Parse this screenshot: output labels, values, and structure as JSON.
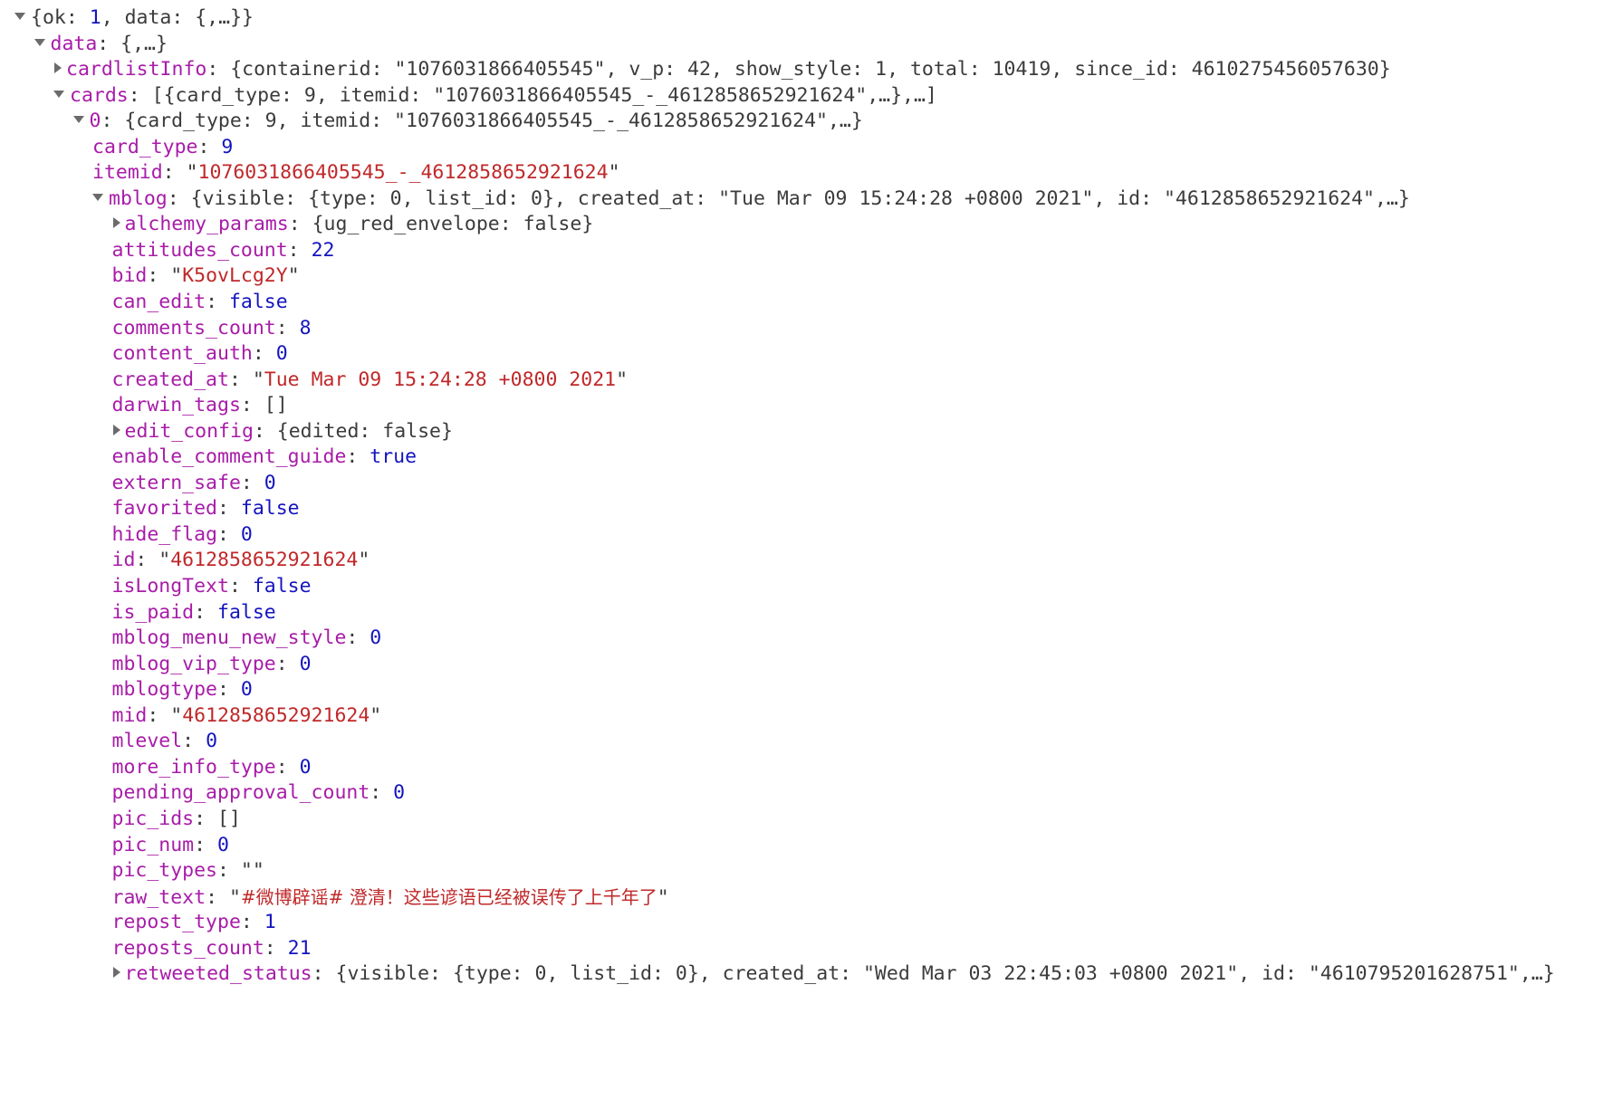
{
  "viewer": {
    "kind": "json-tree",
    "colors": {
      "key": "#a81ca8",
      "string": "#c0282a",
      "number": "#1414bf",
      "boolean": "#1414bf",
      "punctuation": "#3b3b3b",
      "arrow": "#6b6b6b",
      "background": "#ffffff"
    }
  },
  "rows": [
    {
      "id": "root",
      "indent": 0,
      "arrow": "expanded",
      "arrow_icon": "triangle-down-icon",
      "segments": [
        {
          "t": "punct",
          "v": "{"
        },
        {
          "t": "plain",
          "v": "ok: "
        },
        {
          "t": "num",
          "v": "1"
        },
        {
          "t": "plain",
          "v": ", data: {,…}}"
        }
      ]
    },
    {
      "id": "data",
      "indent": 1,
      "arrow": "expanded",
      "arrow_icon": "triangle-down-icon",
      "segments": [
        {
          "t": "key",
          "v": "data"
        },
        {
          "t": "punct",
          "v": ": "
        },
        {
          "t": "plain",
          "v": "{,…}"
        }
      ]
    },
    {
      "id": "cardlistInfo",
      "indent": 2,
      "arrow": "collapsed",
      "arrow_icon": "triangle-right-icon",
      "segments": [
        {
          "t": "key",
          "v": "cardlistInfo"
        },
        {
          "t": "punct",
          "v": ": "
        },
        {
          "t": "plain",
          "v": "{containerid: \"1076031866405545\", v_p: 42, show_style: 1, total: 10419, since_id: 4610275456057630}"
        }
      ]
    },
    {
      "id": "cards",
      "indent": 2,
      "arrow": "expanded",
      "arrow_icon": "triangle-down-icon",
      "segments": [
        {
          "t": "key",
          "v": "cards"
        },
        {
          "t": "punct",
          "v": ": "
        },
        {
          "t": "plain",
          "v": "[{card_type: 9, itemid: \"1076031866405545_-_4612858652921624\",…},…]"
        }
      ]
    },
    {
      "id": "cards-0",
      "indent": 3,
      "arrow": "expanded",
      "arrow_icon": "triangle-down-icon",
      "segments": [
        {
          "t": "key",
          "v": "0"
        },
        {
          "t": "punct",
          "v": ": "
        },
        {
          "t": "plain",
          "v": "{card_type: 9, itemid: \"1076031866405545_-_4612858652921624\",…}"
        }
      ]
    },
    {
      "id": "card_type",
      "indent": 4,
      "arrow": "none",
      "segments": [
        {
          "t": "key",
          "v": "card_type"
        },
        {
          "t": "punct",
          "v": ": "
        },
        {
          "t": "num",
          "v": "9"
        }
      ]
    },
    {
      "id": "itemid",
      "indent": 4,
      "arrow": "none",
      "segments": [
        {
          "t": "key",
          "v": "itemid"
        },
        {
          "t": "punct",
          "v": ": "
        },
        {
          "t": "punct",
          "v": "\""
        },
        {
          "t": "str",
          "v": "1076031866405545_-_4612858652921624"
        },
        {
          "t": "punct",
          "v": "\""
        }
      ]
    },
    {
      "id": "mblog",
      "indent": 4,
      "arrow": "expanded",
      "arrow_icon": "triangle-down-icon",
      "segments": [
        {
          "t": "key",
          "v": "mblog"
        },
        {
          "t": "punct",
          "v": ": "
        },
        {
          "t": "plain",
          "v": "{visible: {type: 0, list_id: 0}, created_at: \"Tue Mar 09 15:24:28 +0800 2021\", id: \"4612858652921624\",…}"
        }
      ]
    },
    {
      "id": "alchemy_params",
      "indent": 5,
      "arrow": "collapsed",
      "arrow_icon": "triangle-right-icon",
      "segments": [
        {
          "t": "key",
          "v": "alchemy_params"
        },
        {
          "t": "punct",
          "v": ": "
        },
        {
          "t": "plain",
          "v": "{ug_red_envelope: false}"
        }
      ]
    },
    {
      "id": "attitudes_count",
      "indent": 5,
      "arrow": "none",
      "segments": [
        {
          "t": "key",
          "v": "attitudes_count"
        },
        {
          "t": "punct",
          "v": ": "
        },
        {
          "t": "num",
          "v": "22"
        }
      ]
    },
    {
      "id": "bid",
      "indent": 5,
      "arrow": "none",
      "segments": [
        {
          "t": "key",
          "v": "bid"
        },
        {
          "t": "punct",
          "v": ": "
        },
        {
          "t": "punct",
          "v": "\""
        },
        {
          "t": "str",
          "v": "K5ovLcg2Y"
        },
        {
          "t": "punct",
          "v": "\""
        }
      ]
    },
    {
      "id": "can_edit",
      "indent": 5,
      "arrow": "none",
      "segments": [
        {
          "t": "key",
          "v": "can_edit"
        },
        {
          "t": "punct",
          "v": ": "
        },
        {
          "t": "bool",
          "v": "false"
        }
      ]
    },
    {
      "id": "comments_count",
      "indent": 5,
      "arrow": "none",
      "segments": [
        {
          "t": "key",
          "v": "comments_count"
        },
        {
          "t": "punct",
          "v": ": "
        },
        {
          "t": "num",
          "v": "8"
        }
      ]
    },
    {
      "id": "content_auth",
      "indent": 5,
      "arrow": "none",
      "segments": [
        {
          "t": "key",
          "v": "content_auth"
        },
        {
          "t": "punct",
          "v": ": "
        },
        {
          "t": "num",
          "v": "0"
        }
      ]
    },
    {
      "id": "created_at",
      "indent": 5,
      "arrow": "none",
      "segments": [
        {
          "t": "key",
          "v": "created_at"
        },
        {
          "t": "punct",
          "v": ": "
        },
        {
          "t": "punct",
          "v": "\""
        },
        {
          "t": "str",
          "v": "Tue Mar 09 15:24:28 +0800 2021"
        },
        {
          "t": "punct",
          "v": "\""
        }
      ]
    },
    {
      "id": "darwin_tags",
      "indent": 5,
      "arrow": "none",
      "segments": [
        {
          "t": "key",
          "v": "darwin_tags"
        },
        {
          "t": "punct",
          "v": ": "
        },
        {
          "t": "plain",
          "v": "[]"
        }
      ]
    },
    {
      "id": "edit_config",
      "indent": 5,
      "arrow": "collapsed",
      "arrow_icon": "triangle-right-icon",
      "segments": [
        {
          "t": "key",
          "v": "edit_config"
        },
        {
          "t": "punct",
          "v": ": "
        },
        {
          "t": "plain",
          "v": "{edited: false}"
        }
      ]
    },
    {
      "id": "enable_comment_guide",
      "indent": 5,
      "arrow": "none",
      "segments": [
        {
          "t": "key",
          "v": "enable_comment_guide"
        },
        {
          "t": "punct",
          "v": ": "
        },
        {
          "t": "bool",
          "v": "true"
        }
      ]
    },
    {
      "id": "extern_safe",
      "indent": 5,
      "arrow": "none",
      "segments": [
        {
          "t": "key",
          "v": "extern_safe"
        },
        {
          "t": "punct",
          "v": ": "
        },
        {
          "t": "num",
          "v": "0"
        }
      ]
    },
    {
      "id": "favorited",
      "indent": 5,
      "arrow": "none",
      "segments": [
        {
          "t": "key",
          "v": "favorited"
        },
        {
          "t": "punct",
          "v": ": "
        },
        {
          "t": "bool",
          "v": "false"
        }
      ]
    },
    {
      "id": "hide_flag",
      "indent": 5,
      "arrow": "none",
      "segments": [
        {
          "t": "key",
          "v": "hide_flag"
        },
        {
          "t": "punct",
          "v": ": "
        },
        {
          "t": "num",
          "v": "0"
        }
      ]
    },
    {
      "id": "id",
      "indent": 5,
      "arrow": "none",
      "segments": [
        {
          "t": "key",
          "v": "id"
        },
        {
          "t": "punct",
          "v": ": "
        },
        {
          "t": "punct",
          "v": "\""
        },
        {
          "t": "str",
          "v": "4612858652921624"
        },
        {
          "t": "punct",
          "v": "\""
        }
      ]
    },
    {
      "id": "isLongText",
      "indent": 5,
      "arrow": "none",
      "segments": [
        {
          "t": "key",
          "v": "isLongText"
        },
        {
          "t": "punct",
          "v": ": "
        },
        {
          "t": "bool",
          "v": "false"
        }
      ]
    },
    {
      "id": "is_paid",
      "indent": 5,
      "arrow": "none",
      "segments": [
        {
          "t": "key",
          "v": "is_paid"
        },
        {
          "t": "punct",
          "v": ": "
        },
        {
          "t": "bool",
          "v": "false"
        }
      ]
    },
    {
      "id": "mblog_menu_new_style",
      "indent": 5,
      "arrow": "none",
      "segments": [
        {
          "t": "key",
          "v": "mblog_menu_new_style"
        },
        {
          "t": "punct",
          "v": ": "
        },
        {
          "t": "num",
          "v": "0"
        }
      ]
    },
    {
      "id": "mblog_vip_type",
      "indent": 5,
      "arrow": "none",
      "segments": [
        {
          "t": "key",
          "v": "mblog_vip_type"
        },
        {
          "t": "punct",
          "v": ": "
        },
        {
          "t": "num",
          "v": "0"
        }
      ]
    },
    {
      "id": "mblogtype",
      "indent": 5,
      "arrow": "none",
      "segments": [
        {
          "t": "key",
          "v": "mblogtype"
        },
        {
          "t": "punct",
          "v": ": "
        },
        {
          "t": "num",
          "v": "0"
        }
      ]
    },
    {
      "id": "mid",
      "indent": 5,
      "arrow": "none",
      "segments": [
        {
          "t": "key",
          "v": "mid"
        },
        {
          "t": "punct",
          "v": ": "
        },
        {
          "t": "punct",
          "v": "\""
        },
        {
          "t": "str",
          "v": "4612858652921624"
        },
        {
          "t": "punct",
          "v": "\""
        }
      ]
    },
    {
      "id": "mlevel",
      "indent": 5,
      "arrow": "none",
      "segments": [
        {
          "t": "key",
          "v": "mlevel"
        },
        {
          "t": "punct",
          "v": ": "
        },
        {
          "t": "num",
          "v": "0"
        }
      ]
    },
    {
      "id": "more_info_type",
      "indent": 5,
      "arrow": "none",
      "segments": [
        {
          "t": "key",
          "v": "more_info_type"
        },
        {
          "t": "punct",
          "v": ": "
        },
        {
          "t": "num",
          "v": "0"
        }
      ]
    },
    {
      "id": "pending_approval_count",
      "indent": 5,
      "arrow": "none",
      "segments": [
        {
          "t": "key",
          "v": "pending_approval_count"
        },
        {
          "t": "punct",
          "v": ": "
        },
        {
          "t": "num",
          "v": "0"
        }
      ]
    },
    {
      "id": "pic_ids",
      "indent": 5,
      "arrow": "none",
      "segments": [
        {
          "t": "key",
          "v": "pic_ids"
        },
        {
          "t": "punct",
          "v": ": "
        },
        {
          "t": "plain",
          "v": "[]"
        }
      ]
    },
    {
      "id": "pic_num",
      "indent": 5,
      "arrow": "none",
      "segments": [
        {
          "t": "key",
          "v": "pic_num"
        },
        {
          "t": "punct",
          "v": ": "
        },
        {
          "t": "num",
          "v": "0"
        }
      ]
    },
    {
      "id": "pic_types",
      "indent": 5,
      "arrow": "none",
      "segments": [
        {
          "t": "key",
          "v": "pic_types"
        },
        {
          "t": "punct",
          "v": ": "
        },
        {
          "t": "punct",
          "v": "\"\""
        }
      ]
    },
    {
      "id": "raw_text",
      "indent": 5,
      "arrow": "none",
      "segments": [
        {
          "t": "key",
          "v": "raw_text"
        },
        {
          "t": "punct",
          "v": ": "
        },
        {
          "t": "punct",
          "v": "\""
        },
        {
          "t": "str cn",
          "v": "#微博辟谣# 澄清！这些谚语已经被误传了上千年了"
        },
        {
          "t": "punct",
          "v": "\""
        }
      ]
    },
    {
      "id": "repost_type",
      "indent": 5,
      "arrow": "none",
      "segments": [
        {
          "t": "key",
          "v": "repost_type"
        },
        {
          "t": "punct",
          "v": ": "
        },
        {
          "t": "num",
          "v": "1"
        }
      ]
    },
    {
      "id": "reposts_count",
      "indent": 5,
      "arrow": "none",
      "segments": [
        {
          "t": "key",
          "v": "reposts_count"
        },
        {
          "t": "punct",
          "v": ": "
        },
        {
          "t": "num",
          "v": "21"
        }
      ]
    },
    {
      "id": "retweeted_status",
      "indent": 5,
      "arrow": "collapsed",
      "arrow_icon": "triangle-right-icon",
      "segments": [
        {
          "t": "key",
          "v": "retweeted_status"
        },
        {
          "t": "punct",
          "v": ": "
        },
        {
          "t": "plain",
          "v": "{visible: {type: 0, list_id: 0}, created_at: \"Wed Mar 03 22:45:03 +0800 2021\", id: \"4610795201628751\",…}"
        }
      ]
    }
  ]
}
